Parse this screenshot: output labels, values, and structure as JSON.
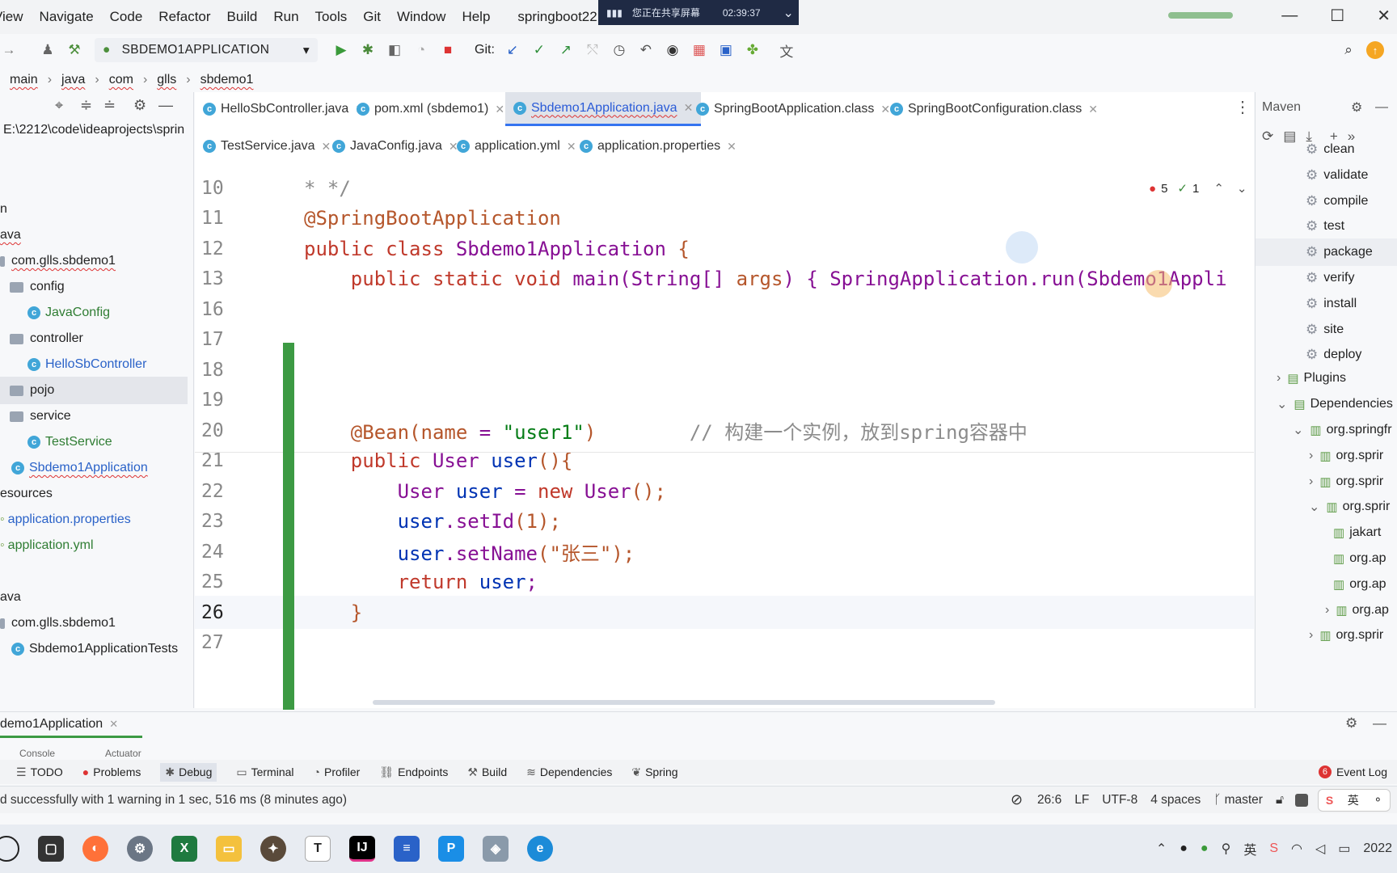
{
  "menu": [
    "View",
    "Navigate",
    "Code",
    "Refactor",
    "Build",
    "Run",
    "Tools",
    "Git",
    "Window",
    "Help"
  ],
  "project_title": "springboot22",
  "share_bar": {
    "text": "您正在共享屏幕",
    "time": "02:39:37"
  },
  "toolbar": {
    "run_config": "SBDEMO1APPLICATION",
    "git_label": "Git:"
  },
  "breadcrumb": [
    "main",
    "java",
    "com",
    "glls",
    "sbdemo1"
  ],
  "project_tree": {
    "path": "E:\\2212\\code\\ideaprojects\\sprin",
    "items": [
      "n",
      "ava",
      "com.glls.sbdemo1",
      "config",
      "JavaConfig",
      "controller",
      "HelloSbController",
      "pojo",
      "service",
      "TestService",
      "Sbdemo1Application",
      "esources",
      "application.properties",
      "application.yml",
      "ava",
      "com.glls.sbdemo1",
      "Sbdemo1ApplicationTests"
    ]
  },
  "tabs_row1": [
    "HelloSbController.java",
    "pom.xml (sbdemo1)",
    "Sbdemo1Application.java",
    "SpringBootApplication.class",
    "SpringBootConfiguration.class"
  ],
  "tabs_row2": [
    "TestService.java",
    "JavaConfig.java",
    "application.yml",
    "application.properties"
  ],
  "inspections": {
    "errors": "5",
    "warnings": "1"
  },
  "code_lines": [
    {
      "n": "10",
      "parts": [
        {
          "t": "* */",
          "c": "cm"
        }
      ]
    },
    {
      "n": "11",
      "parts": [
        {
          "t": "@SpringBootApplication",
          "c": "an"
        }
      ]
    },
    {
      "n": "12",
      "parts": [
        {
          "t": "public class ",
          "c": "kw2"
        },
        {
          "t": "Sbdemo1Application",
          "c": "pm"
        },
        {
          "t": " {",
          "c": "an"
        }
      ]
    },
    {
      "n": "13",
      "parts": [
        {
          "t": "    public static void ",
          "c": "kw2"
        },
        {
          "t": "main",
          "c": "pm"
        },
        {
          "t": "(String[] ",
          "c": "pm"
        },
        {
          "t": "args",
          "c": "an"
        },
        {
          "t": ") { ",
          "c": "pm"
        },
        {
          "t": "SpringApplication.",
          "c": "pm"
        },
        {
          "t": "run",
          "c": "pm"
        },
        {
          "t": "(Sbdemo1Appli",
          "c": "pm"
        }
      ]
    },
    {
      "n": "16",
      "parts": []
    },
    {
      "n": "17",
      "parts": []
    },
    {
      "n": "18",
      "parts": []
    },
    {
      "n": "19",
      "parts": []
    },
    {
      "n": "20",
      "parts": [
        {
          "t": "    @Bean(",
          "c": "an"
        },
        {
          "t": "name",
          "c": "an"
        },
        {
          "t": " = ",
          "c": "pm"
        },
        {
          "t": "\"user1\"",
          "c": "str"
        },
        {
          "t": ")        ",
          "c": "an"
        },
        {
          "t": "// 构建一个实例，放到spring容器中",
          "c": "cm"
        }
      ]
    },
    {
      "n": "21",
      "parts": [
        {
          "t": "    public ",
          "c": "kw2"
        },
        {
          "t": "User",
          "c": "pm"
        },
        {
          "t": " user",
          "c": "kw"
        },
        {
          "t": "(){",
          "c": "an"
        }
      ]
    },
    {
      "n": "22",
      "parts": [
        {
          "t": "        User ",
          "c": "pm"
        },
        {
          "t": "user",
          "c": "kw"
        },
        {
          "t": " = ",
          "c": "pm"
        },
        {
          "t": "new ",
          "c": "kw2"
        },
        {
          "t": "User",
          "c": "pm"
        },
        {
          "t": "();",
          "c": "an"
        }
      ]
    },
    {
      "n": "23",
      "parts": [
        {
          "t": "        user",
          "c": "kw"
        },
        {
          "t": ".",
          "c": "pm"
        },
        {
          "t": "setId",
          "c": "pm"
        },
        {
          "t": "(1);",
          "c": "an"
        }
      ]
    },
    {
      "n": "24",
      "parts": [
        {
          "t": "        user",
          "c": "kw"
        },
        {
          "t": ".",
          "c": "pm"
        },
        {
          "t": "setName",
          "c": "pm"
        },
        {
          "t": "(\"张三\");",
          "c": "an"
        }
      ]
    },
    {
      "n": "25",
      "parts": [
        {
          "t": "        return ",
          "c": "kw2"
        },
        {
          "t": "user",
          "c": "kw"
        },
        {
          "t": ";",
          "c": "pm"
        }
      ]
    },
    {
      "n": "26",
      "parts": [
        {
          "t": "    }",
          "c": "an"
        }
      ]
    },
    {
      "n": "27",
      "parts": []
    }
  ],
  "maven": {
    "title": "Maven",
    "lifecycle": [
      "clean",
      "validate",
      "compile",
      "test",
      "package",
      "verify",
      "install",
      "site",
      "deploy"
    ],
    "plugins": "Plugins",
    "dependencies": "Dependencies",
    "deps": [
      "org.springfr",
      "org.sprir",
      "org.sprir",
      "org.sprir",
      "jakart",
      "org.ap",
      "org.ap",
      "org.ap",
      "org.sprir"
    ]
  },
  "debug": {
    "session_tab": "demo1Application",
    "console": "Console",
    "actuator": "Actuator"
  },
  "bottom_tools": [
    "TODO",
    "Problems",
    "Debug",
    "Terminal",
    "Profiler",
    "Endpoints",
    "Build",
    "Dependencies",
    "Spring"
  ],
  "event_log": {
    "count": "6",
    "label": "Event Log"
  },
  "status": {
    "message": "d successfully with 1 warning in 1 sec, 516 ms (8 minutes ago)",
    "position": "26:6",
    "line_sep": "LF",
    "encoding": "UTF-8",
    "indent": "4 spaces",
    "branch": "master"
  },
  "taskbar": {
    "date": "2022"
  }
}
